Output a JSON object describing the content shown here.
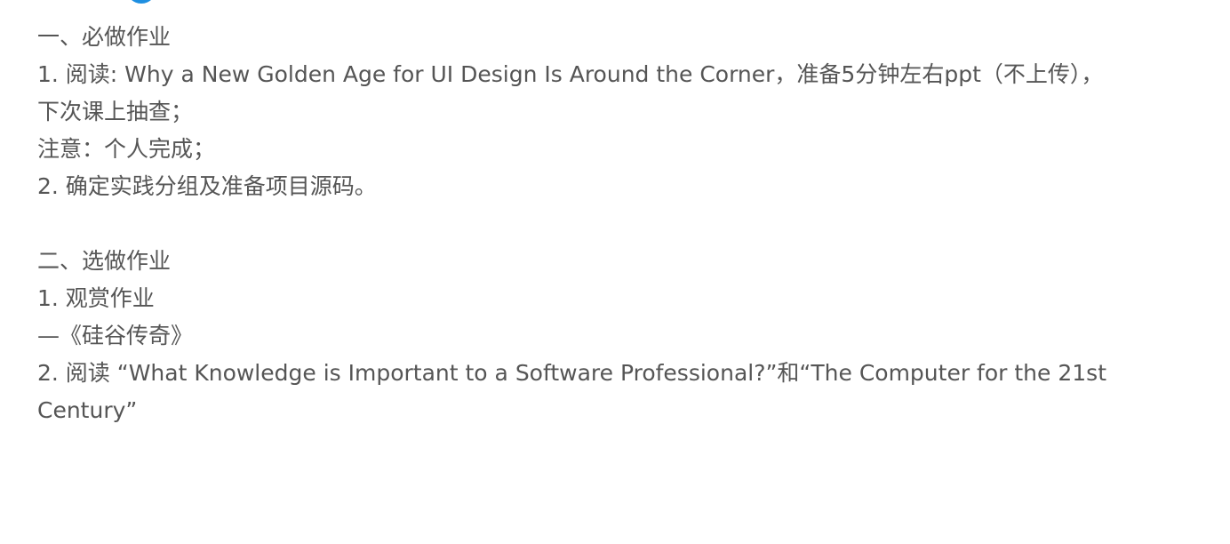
{
  "assignment": {
    "required_title": "一、必做作业",
    "required_item_1_a": "1. 阅读: Why a New Golden Age for UI Design Is Around the Corner，准备5分钟左右ppt（不上传），",
    "required_item_1_b": "下次课上抽查；",
    "required_note": "注意：个人完成；",
    "required_item_2": "2. 确定实践分组及准备项目源码。",
    "optional_title": "二、选做作业",
    "optional_item_1": "1. 观赏作业",
    "optional_item_1_sub": "—《硅谷传奇》",
    "optional_item_2_a": "2. 阅读 “What Knowledge is Important to a Software Professional?”和“The Computer for the 21st",
    "optional_item_2_b": "Century”"
  }
}
